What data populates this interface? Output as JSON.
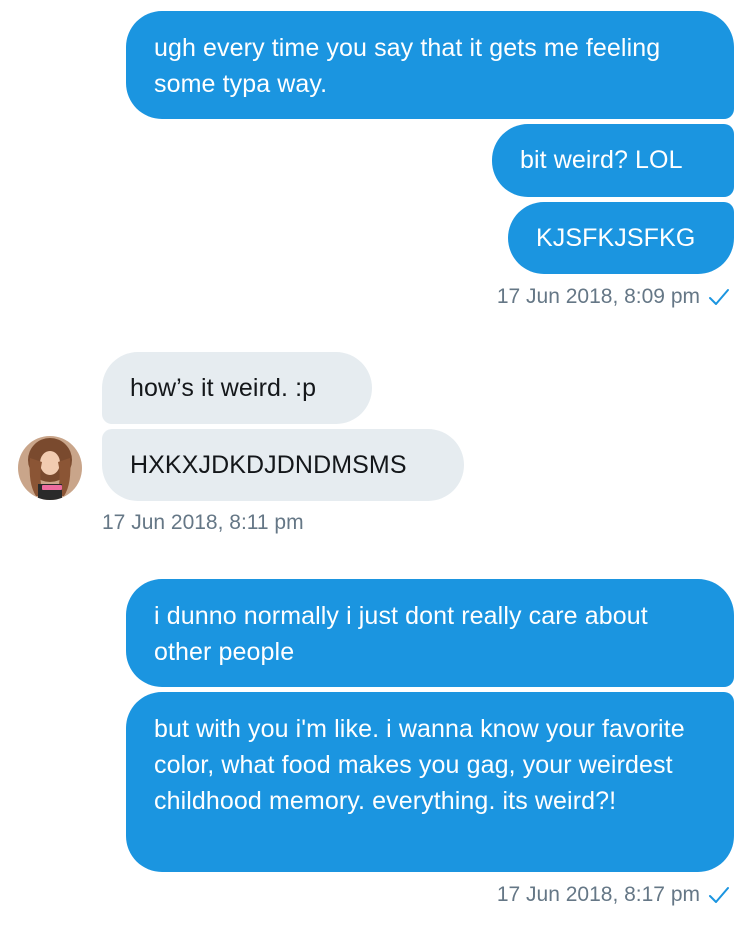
{
  "conversation": {
    "group1": {
      "msg1": "ugh every time you say that it gets me feeling some typa way.",
      "msg2": "bit weird? LOL",
      "msg3": "KJSFKJSFKG",
      "timestamp": "17 Jun 2018, 8:09 pm"
    },
    "group2": {
      "msg1": "how’s it weird. :p",
      "msg2": "HXKXJDKDJDNDMSMS",
      "timestamp": "17 Jun 2018, 8:11 pm"
    },
    "group3": {
      "msg1": "i dunno normally i just dont really care about other people",
      "msg2": "but with you i'm like. i wanna know your favorite color, what food makes you gag, your weirdest childhood memory. everything. its weird?!",
      "timestamp": "17 Jun 2018, 8:17 pm"
    }
  },
  "colors": {
    "sent_bubble": "#1b95e0",
    "received_bubble": "#e6ecf0",
    "timestamp": "#657786"
  },
  "icons": {
    "read_receipt": "check-icon",
    "contact_avatar": "avatar"
  }
}
